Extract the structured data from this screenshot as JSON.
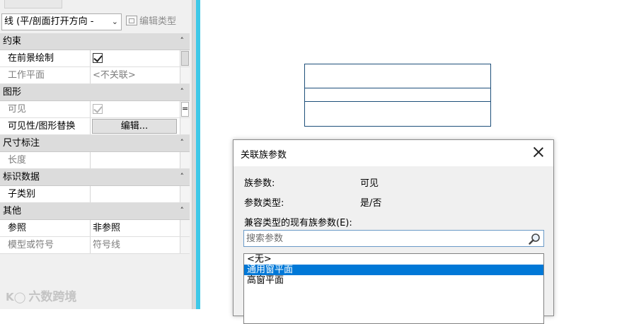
{
  "properties_panel": {
    "type_selector": "线 (平/剖面打开方向 -",
    "edit_type_label": "编辑类型",
    "categories": [
      {
        "label": "约束",
        "collapse_glyph": "˄",
        "rows": [
          {
            "label": "在前景绘制",
            "value": "",
            "checkbox": true,
            "dim": false
          },
          {
            "label": "工作平面",
            "value": "<不关联>",
            "checkbox": false,
            "dim": true
          }
        ]
      },
      {
        "label": "图形",
        "collapse_glyph": "˄",
        "rows": [
          {
            "label": "可见",
            "value": "",
            "checkbox": true,
            "dim": true,
            "param_button": "="
          },
          {
            "label": "可见性/图形替换",
            "value": "编辑...",
            "button": true,
            "dim": false
          }
        ]
      },
      {
        "label": "尺寸标注",
        "collapse_glyph": "˄",
        "rows": [
          {
            "label": "长度",
            "value": "",
            "dim": true
          }
        ]
      },
      {
        "label": "标识数据",
        "collapse_glyph": "˄",
        "rows": [
          {
            "label": "子类别",
            "value": "",
            "dim": false
          }
        ]
      },
      {
        "label": "其他",
        "collapse_glyph": "˄",
        "rows": [
          {
            "label": "参照",
            "value": "非参照",
            "dim": false
          },
          {
            "label": "模型或符号",
            "value": "符号线",
            "dim": true
          }
        ]
      }
    ]
  },
  "dialog": {
    "title": "关联族参数",
    "family_param_label": "族参数:",
    "family_param_value": "可见",
    "param_type_label": "参数类型:",
    "param_type_value": "是/否",
    "compatible_label": "兼容类型的现有族参数(E):",
    "search_placeholder": "搜索参数",
    "list_items": [
      "<无>",
      "通用窗平面",
      "高窗平面"
    ],
    "selected_index": 1
  },
  "watermark": "六数跨境",
  "colors": {
    "selection": "#0078d7",
    "accent_strip": "#3ec8e8",
    "drawing_line": "#1e4f7a"
  }
}
